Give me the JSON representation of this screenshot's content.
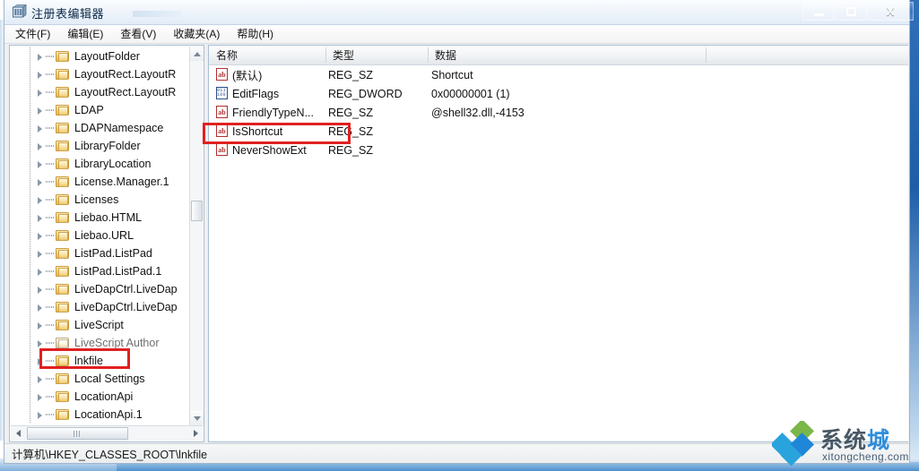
{
  "window": {
    "title": "注册表编辑器",
    "icon": "registry-editor-icon",
    "controls": {
      "minimize": "minimize-button",
      "maximize": "maximize-button",
      "close_label": "X"
    }
  },
  "menubar": {
    "items": [
      {
        "label": "文件(F)",
        "name": "menu-file"
      },
      {
        "label": "编辑(E)",
        "name": "menu-edit"
      },
      {
        "label": "查看(V)",
        "name": "menu-view"
      },
      {
        "label": "收藏夹(A)",
        "name": "menu-favorites"
      },
      {
        "label": "帮助(H)",
        "name": "menu-help"
      }
    ]
  },
  "tree": {
    "items": [
      {
        "label": "LayoutFolder",
        "faded": false
      },
      {
        "label": "LayoutRect.LayoutR",
        "faded": false
      },
      {
        "label": "LayoutRect.LayoutR",
        "faded": false
      },
      {
        "label": "LDAP",
        "faded": false
      },
      {
        "label": "LDAPNamespace",
        "faded": false
      },
      {
        "label": "LibraryFolder",
        "faded": false
      },
      {
        "label": "LibraryLocation",
        "faded": false
      },
      {
        "label": "License.Manager.1",
        "faded": false
      },
      {
        "label": "Licenses",
        "faded": false
      },
      {
        "label": "Liebao.HTML",
        "faded": false
      },
      {
        "label": "Liebao.URL",
        "faded": false
      },
      {
        "label": "ListPad.ListPad",
        "faded": false
      },
      {
        "label": "ListPad.ListPad.1",
        "faded": false
      },
      {
        "label": "LiveDapCtrl.LiveDap",
        "faded": false
      },
      {
        "label": "LiveDapCtrl.LiveDap",
        "faded": false
      },
      {
        "label": "LiveScript",
        "faded": false
      },
      {
        "label": "LiveScript Author",
        "faded": true
      },
      {
        "label": "lnkfile",
        "faded": false,
        "highlighted": true
      },
      {
        "label": "Local Settings",
        "faded": false
      },
      {
        "label": "LocationApi",
        "faded": false
      },
      {
        "label": "LocationApi.1",
        "faded": false
      }
    ],
    "selected": "lnkfile",
    "scrollbars": {
      "vertical": "tree-vertical-scrollbar",
      "horizontal": "tree-horizontal-scrollbar"
    }
  },
  "list": {
    "columns": [
      {
        "label": "名称",
        "name": "column-name"
      },
      {
        "label": "类型",
        "name": "column-type"
      },
      {
        "label": "数据",
        "name": "column-data"
      }
    ],
    "rows": [
      {
        "name": "(默认)",
        "type": "REG_SZ",
        "data": "Shortcut",
        "icon": "string-value-icon",
        "highlighted": false
      },
      {
        "name": "EditFlags",
        "type": "REG_DWORD",
        "data": "0x00000001 (1)",
        "icon": "binary-value-icon",
        "highlighted": false
      },
      {
        "name": "FriendlyTypeN...",
        "type": "REG_SZ",
        "data": "@shell32.dll,-4153",
        "icon": "string-value-icon",
        "highlighted": false
      },
      {
        "name": "IsShortcut",
        "type": "REG_SZ",
        "data": "",
        "icon": "string-value-icon",
        "highlighted": true
      },
      {
        "name": "NeverShowExt",
        "type": "REG_SZ",
        "data": "",
        "icon": "string-value-icon",
        "highlighted": false
      }
    ]
  },
  "statusbar": {
    "path": "计算机\\HKEY_CLASSES_ROOT\\lnkfile"
  },
  "watermark": {
    "text_main": "系统",
    "text_accent": "城",
    "subtitle": "xitongcheng.com",
    "logo": "diamond-logo-icon"
  },
  "colors": {
    "highlight_red": "#e02020",
    "title_blue": "#1d5da8",
    "accent_blue": "#1f86d8",
    "folder_yellow": "#f5d27a"
  }
}
